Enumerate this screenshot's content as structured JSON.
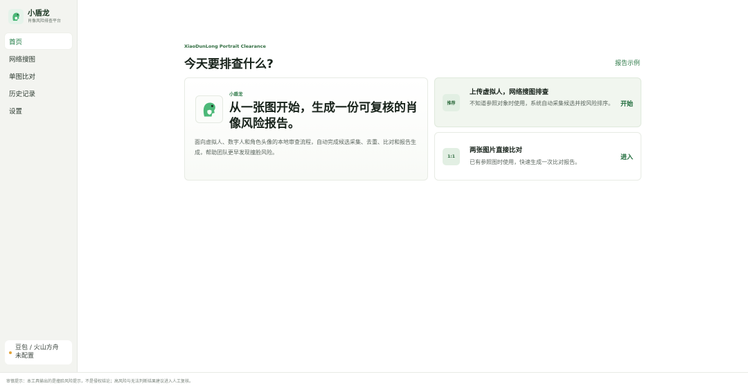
{
  "brand": {
    "name": "小盾龙",
    "subtitle": "肖像风险排查平台"
  },
  "nav": {
    "items": [
      {
        "label": "首页",
        "active": true
      },
      {
        "label": "网络搜图"
      },
      {
        "label": "单图比对"
      },
      {
        "label": "历史记录"
      },
      {
        "label": "设置"
      }
    ]
  },
  "model": {
    "line1": "豆包 / 火山方舟",
    "line2": "未配置",
    "status_color": "#e3a53a"
  },
  "main": {
    "eyebrow": "XiaoDunLong Portrait Clearance",
    "title": "今天要排查什么?",
    "report_link": "报告示例"
  },
  "hero": {
    "tag": "小盾龙",
    "headline": "从一张图开始，生成一份可复核的肖像风险报告。",
    "description": "面向虚拟人、数字人和角色头像的本地审查流程，自动完成候选采集、去重、比对和报告生成，帮助团队更早发现撞脸风险。"
  },
  "cards": [
    {
      "badge": "推荐",
      "title": "上传虚拟人，网络搜图排查",
      "description": "不知道参照对象时使用，系统自动采集候选并按风险排序。",
      "action": "开始"
    },
    {
      "badge": "1:1",
      "title": "两张图片直接比对",
      "description": "已有参照图时使用，快速生成一次比对报告。",
      "action": "进入"
    }
  ],
  "footer": {
    "text": "审慎提示：本工具输出的是撞脸风险提示，不是侵权结论；高风险与无法判断结果建议进入人工复核。"
  },
  "colors": {
    "accent": "#1e7a43",
    "mascot": "#4cb878",
    "sidebar_bg": "#f3f4f0"
  },
  "icons": {
    "brand": "dragon-mascot-icon"
  }
}
